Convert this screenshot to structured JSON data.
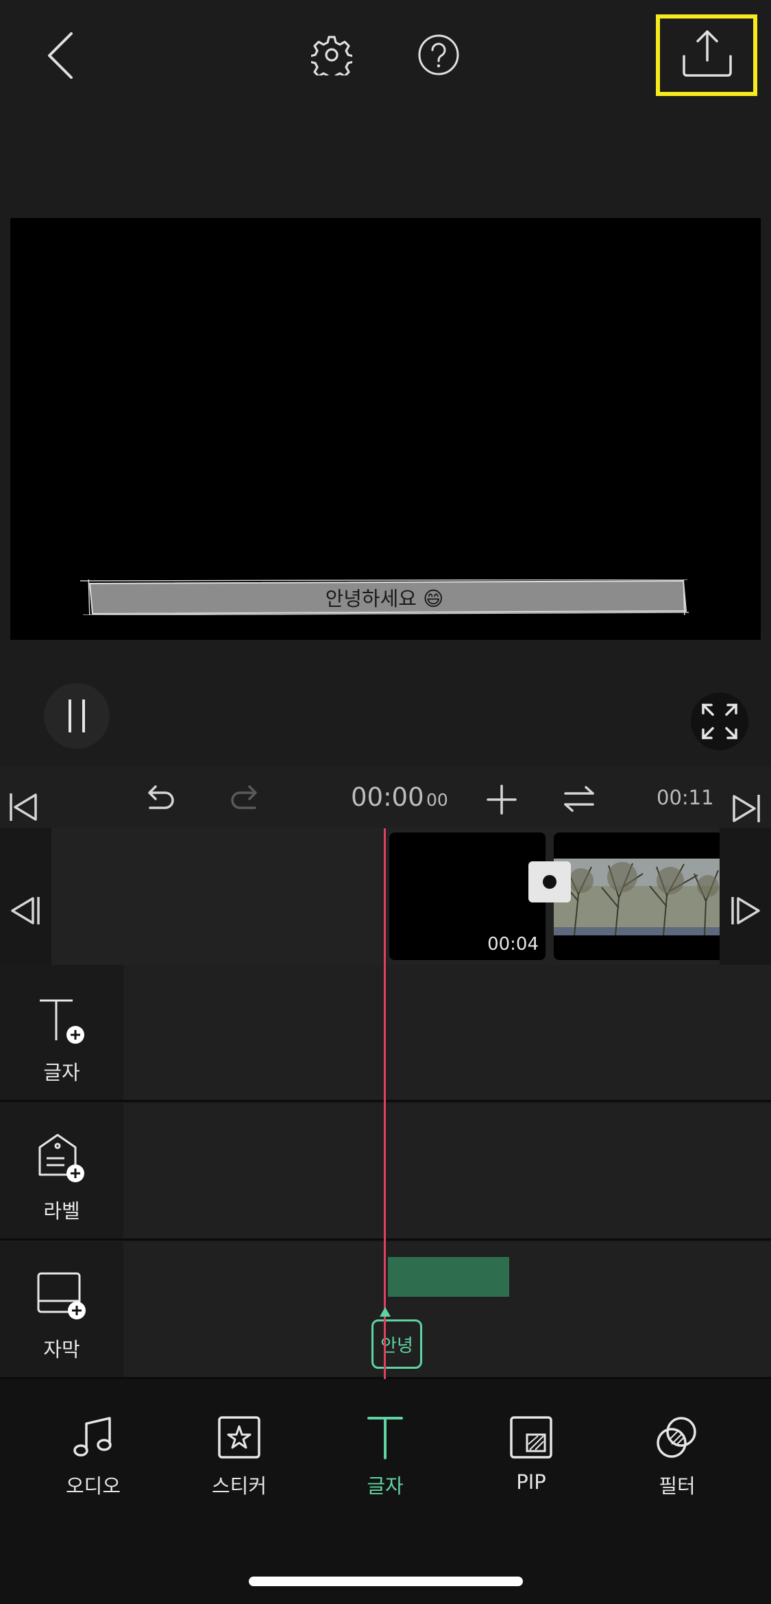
{
  "header": {
    "back_icon": "chevron-left-icon",
    "settings_icon": "gear-icon",
    "help_icon": "question-circle-icon",
    "export_icon": "upload-icon",
    "highlight_color": "#f7ea1d"
  },
  "preview": {
    "subtitle_text": "안녕하세요 😄"
  },
  "timeline_toolbar": {
    "current_time": "00:00",
    "current_frames": "00",
    "total_time": "00:11"
  },
  "clip_track": {
    "clip_duration": "00:04"
  },
  "layers": [
    {
      "label": "글자",
      "icon": "text-add-icon"
    },
    {
      "label": "라벨",
      "icon": "label-add-icon"
    },
    {
      "label": "자막",
      "icon": "caption-add-icon"
    }
  ],
  "caption_clip": {
    "tag_text": "안녕",
    "color": "#2f6d4f"
  },
  "bottom_nav": {
    "items": [
      {
        "label": "오디오",
        "icon": "music-note-icon"
      },
      {
        "label": "스티커",
        "icon": "sticker-star-icon"
      },
      {
        "label": "글자",
        "icon": "text-t-icon",
        "active": true
      },
      {
        "label": "PIP",
        "icon": "pip-icon"
      },
      {
        "label": "필터",
        "icon": "filter-circles-icon"
      }
    ],
    "accent_color": "#5fd3a2"
  }
}
